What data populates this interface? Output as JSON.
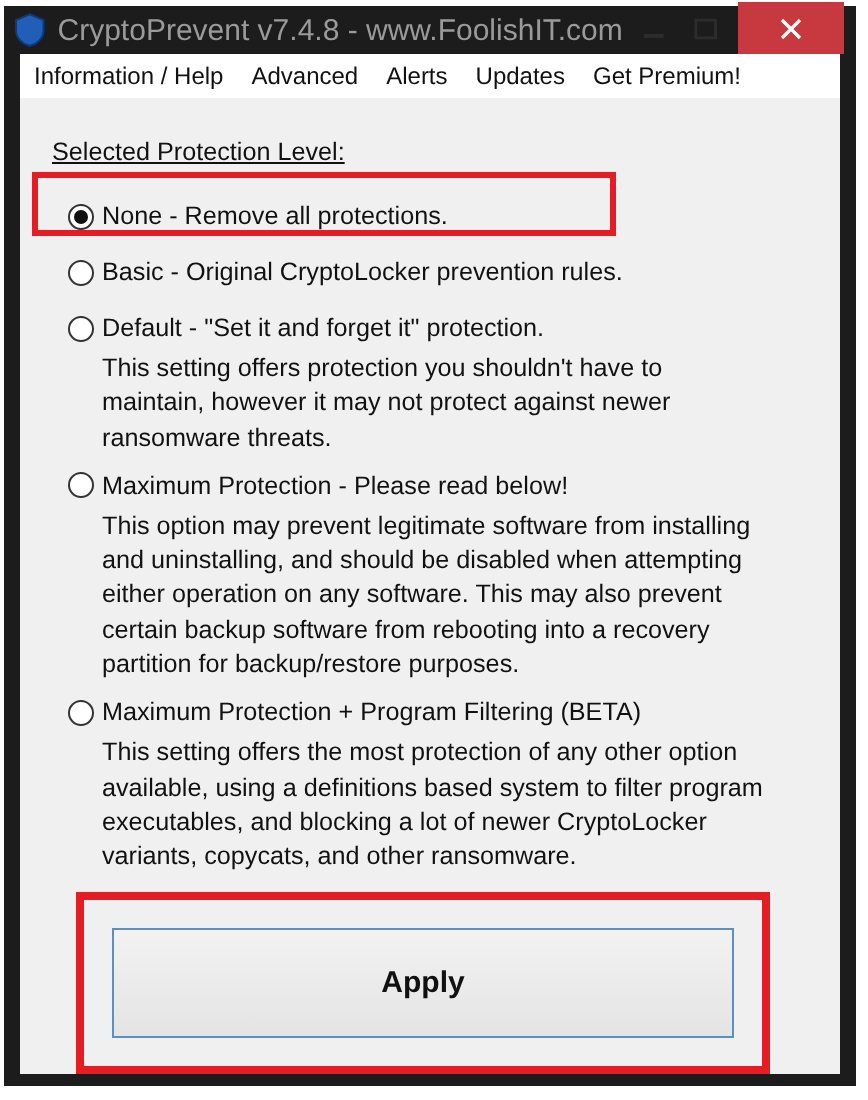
{
  "window": {
    "title": "CryptoPrevent v7.4.8 - www.FoolishIT.com"
  },
  "menu": [
    "Information / Help",
    "Advanced",
    "Alerts",
    "Updates",
    "Get Premium!"
  ],
  "group_label": "Selected Protection Level:",
  "options": [
    {
      "label": "None - Remove all protections.",
      "selected": true,
      "highlighted": true
    },
    {
      "label": "Basic - Original CryptoLocker prevention rules.",
      "selected": false,
      "highlighted": false
    },
    {
      "label": "Default - \"Set it and forget it\" protection.",
      "selected": false,
      "highlighted": false,
      "description": "This setting offers protection you shouldn't have to\nmaintain, however it may not protect against newer\nransomware threats."
    },
    {
      "label": "Maximum Protection - Please read below!",
      "selected": false,
      "highlighted": false,
      "description": "This option may prevent legitimate software from installing\nand uninstalling, and should be disabled when attempting\neither operation on any software.  This may also prevent\ncertain backup software from rebooting into a recovery\npartition for backup/restore purposes."
    },
    {
      "label": "Maximum Protection + Program Filtering (BETA)",
      "selected": false,
      "highlighted": false,
      "description": "This setting offers the most protection of any other option\navailable, using a definitions based system to filter program\nexecutables, and blocking a lot of newer CryptoLocker\nvariants, copycats, and other ransomware."
    }
  ],
  "apply_button": {
    "label": "Apply",
    "highlighted": true
  }
}
